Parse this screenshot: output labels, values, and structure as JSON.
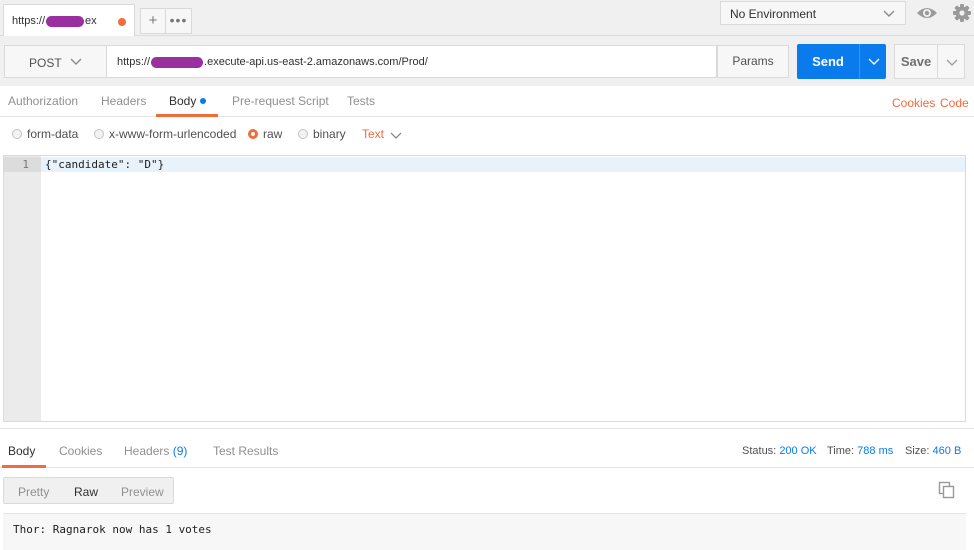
{
  "tab": {
    "label_prefix": "https://",
    "label_suffix": "ex"
  },
  "environment": {
    "selected": "No Environment"
  },
  "request": {
    "method": "POST",
    "url_prefix": "https://",
    "url_suffix": ".execute-api.us-east-2.amazonaws.com/Prod/",
    "params_label": "Params",
    "send_label": "Send",
    "save_label": "Save"
  },
  "request_tabs": [
    "Authorization",
    "Headers",
    "Body",
    "Pre-request Script",
    "Tests"
  ],
  "request_links": [
    "Cookies",
    "Code"
  ],
  "body_types": [
    "form-data",
    "x-www-form-urlencoded",
    "raw",
    "binary"
  ],
  "body_type_selected": "raw",
  "raw_format": "Text",
  "editor": {
    "line_number": "1",
    "code": "{\"candidate\": \"D\"}"
  },
  "response_tabs": {
    "body": "Body",
    "cookies": "Cookies",
    "headers": "Headers",
    "headers_count": "(9)",
    "test_results": "Test Results"
  },
  "response_meta": {
    "status_label": "Status:",
    "status_value": "200 OK",
    "time_label": "Time:",
    "time_value": "788 ms",
    "size_label": "Size:",
    "size_value": "460 B"
  },
  "response_views": [
    "Pretty",
    "Raw",
    "Preview"
  ],
  "response_view_selected": "Raw",
  "response_body": "Thor: Ragnarok now has 1 votes",
  "colors": {
    "accent": "#f26b3a",
    "send": "#097bed",
    "redaction": "#9a2fa0"
  }
}
